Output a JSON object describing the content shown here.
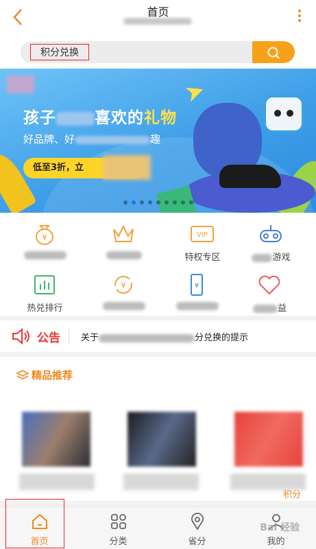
{
  "header": {
    "title": "首页",
    "back_icon": "chevron-left-icon",
    "more_icon": "more-vertical-icon"
  },
  "search": {
    "value": "积分兑换",
    "button_icon": "search-icon"
  },
  "banner": {
    "title_prefix": "孩子",
    "title_mid": "喜欢的",
    "title_highlight": "礼物",
    "subtitle": "好品牌、好",
    "subtitle_tail": "趣",
    "button_label": "低至3折，立",
    "active_dot": 1,
    "dot_count": 9
  },
  "categories": [
    {
      "label": "",
      "icon": "money-bag-icon"
    },
    {
      "label": "",
      "icon": "crown-icon"
    },
    {
      "label": "特权专区",
      "icon": "vip-icon"
    },
    {
      "label": "游戏",
      "icon": "gamepad-icon"
    },
    {
      "label": "热兑排行",
      "icon": "bar-chart-icon"
    },
    {
      "label": "",
      "icon": "coin-exchange-icon"
    },
    {
      "label": "",
      "icon": "phone-icon"
    },
    {
      "label": "益",
      "icon": "heart-icon"
    }
  ],
  "notice": {
    "label": "公告",
    "text_prefix": "关于",
    "text_suffix": "分兑换的提示",
    "icon": "speaker-icon"
  },
  "recommend": {
    "title": "精品推荐",
    "icon": "layers-icon",
    "price_tail": "积分"
  },
  "nav": [
    {
      "label": "首页",
      "icon": "home-icon",
      "active": true
    },
    {
      "label": "分类",
      "icon": "grid-icon",
      "active": false
    },
    {
      "label": "省分",
      "icon": "location-icon",
      "active": false
    },
    {
      "label": "我的",
      "icon": "user-icon",
      "active": false
    }
  ],
  "watermark": "Bai 经验",
  "colors": {
    "accent": "#f08a1c",
    "search_button": "#f7a11a",
    "notice": "#e33333",
    "banner_blue": "#3e9ee8"
  }
}
